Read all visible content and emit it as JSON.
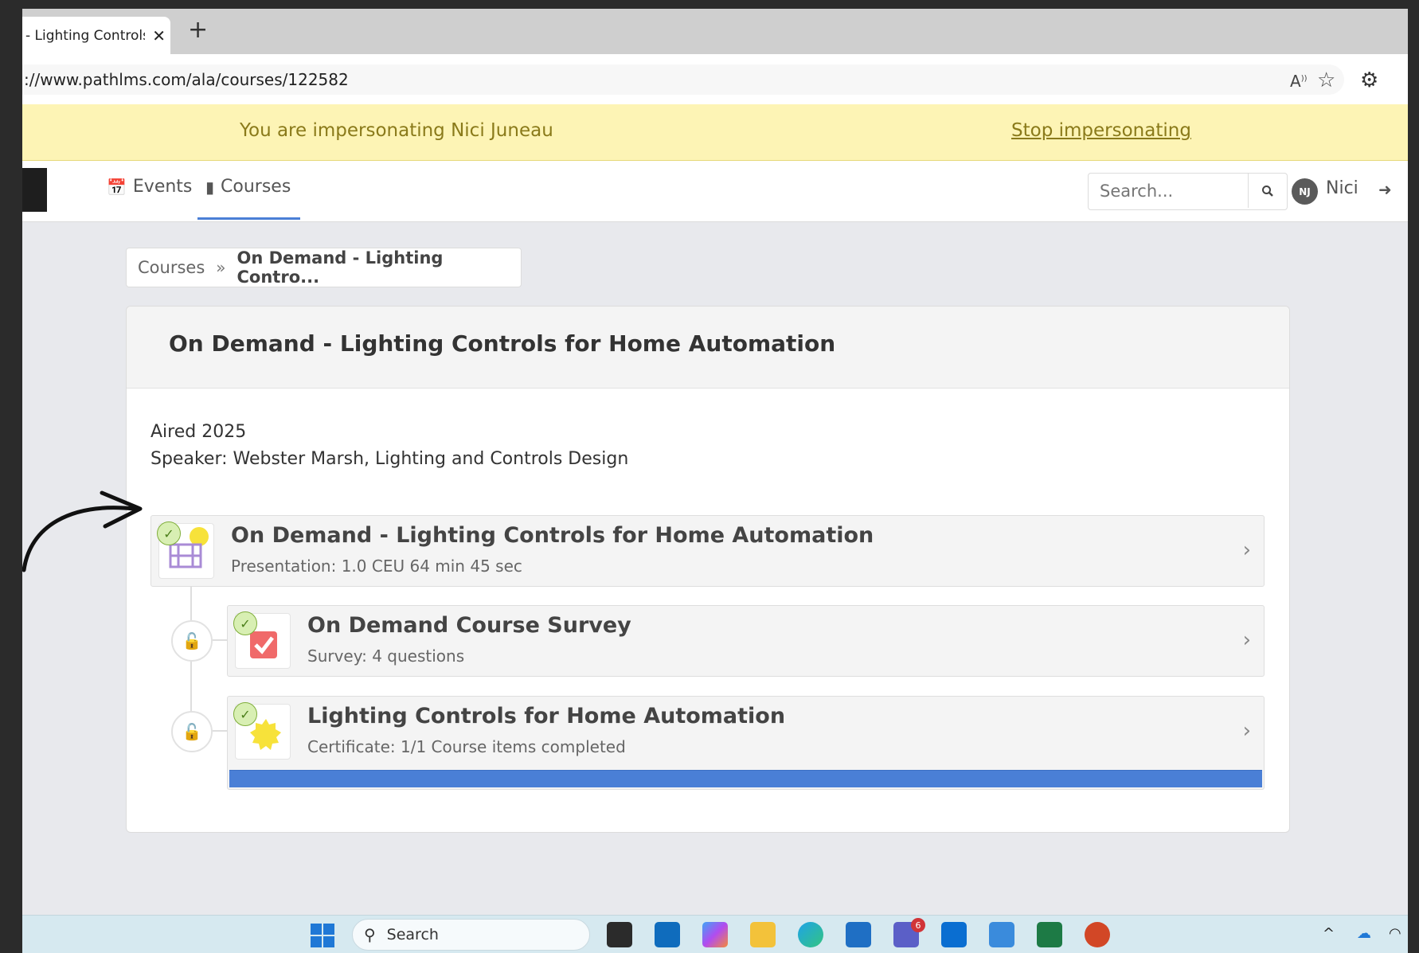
{
  "browser": {
    "tab_title": "- Lighting Controls for Home Automation",
    "tab_close": "✕",
    "new_tab": "+",
    "url": "://www.pathlms.com/ala/courses/122582",
    "read_aloud": "À⁾",
    "favorite": "☆",
    "extensions": "⚙"
  },
  "banner": {
    "message": "You are impersonating Nici Juneau",
    "stop_link": "Stop impersonating"
  },
  "nav": {
    "events_label": "Events",
    "courses_label": "Courses",
    "search_placeholder": "Search...",
    "avatar_initials": "NJ",
    "user_name": "Nici"
  },
  "breadcrumb": {
    "parent": "Courses",
    "separator": "»",
    "current": "On Demand - Lighting Contro..."
  },
  "course": {
    "title": "On Demand - Lighting Controls for Home Automation",
    "aired": "Aired 2025",
    "speaker": "Speaker: Webster Marsh, Lighting and Controls Design",
    "items": [
      {
        "title": "On Demand - Lighting Controls for Home Automation",
        "subtitle": "Presentation:  1.0 CEU  64 min 45 sec",
        "icon": "film-icon",
        "completed": true
      },
      {
        "title": "On Demand Course Survey",
        "subtitle": "Survey: 4 questions",
        "icon": "survey-checkbox-icon",
        "completed": true
      },
      {
        "title": "Lighting Controls for Home Automation",
        "subtitle": "Certificate:  1/1 Course items completed",
        "icon": "certificate-seal-icon",
        "completed": true,
        "progress_percent": 100
      }
    ]
  },
  "taskbar": {
    "search_label": "Search",
    "teams_badge": "6"
  },
  "colors": {
    "banner_bg": "#fdf4b5",
    "accent_blue": "#4a7fd6",
    "check_green": "#7fae3a"
  }
}
